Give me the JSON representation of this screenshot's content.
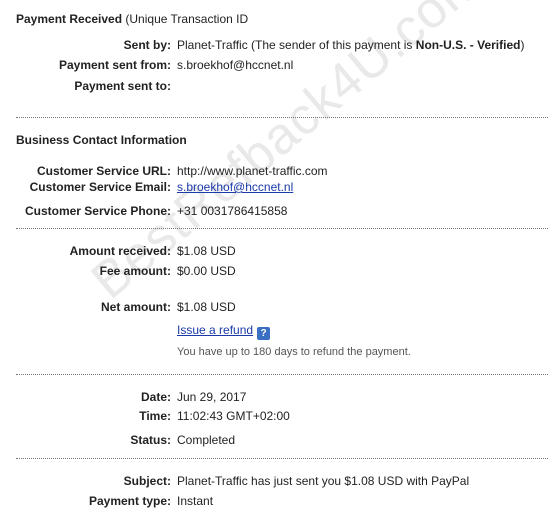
{
  "watermark": "BestRefback4U.com",
  "header": {
    "title_bold": "Payment Received",
    "title_rest": " (Unique Transaction ID"
  },
  "sender": {
    "sent_by_label": "Sent by:",
    "sent_by_value_prefix": "Planet-Traffic (The sender of this payment is ",
    "sent_by_status": "Non-U.S. - Verified",
    "sent_by_value_suffix": ")",
    "sent_from_label": "Payment sent from:",
    "sent_from_value": "s.broekhof@hccnet.nl",
    "sent_to_label": "Payment sent to:",
    "sent_to_value": ""
  },
  "business": {
    "section_title": "Business Contact Information",
    "url_label": "Customer Service URL:",
    "url_value": "http://www.planet-traffic.com",
    "email_label": "Customer Service Email:",
    "email_value": "s.broekhof@hccnet.nl",
    "phone_label": "Customer Service Phone:",
    "phone_value": "+31 0031786415858"
  },
  "amounts": {
    "received_label": "Amount received:",
    "received_value": "$1.08 USD",
    "fee_label": "Fee amount:",
    "fee_value": "$0.00 USD",
    "net_label": "Net amount:",
    "net_value": "$1.08 USD",
    "refund_link": "Issue a refund",
    "help_icon_glyph": "?",
    "refund_note": "You have up to 180 days to refund the payment."
  },
  "timing": {
    "date_label": "Date:",
    "date_value": "Jun 29, 2017",
    "time_label": "Time:",
    "time_value": "11:02:43 GMT+02:00",
    "status_label": "Status:",
    "status_value": "Completed"
  },
  "details": {
    "subject_label": "Subject:",
    "subject_value": "Planet-Traffic has just sent you $1.08 USD with PayPal",
    "type_label": "Payment type:",
    "type_value": "Instant"
  }
}
